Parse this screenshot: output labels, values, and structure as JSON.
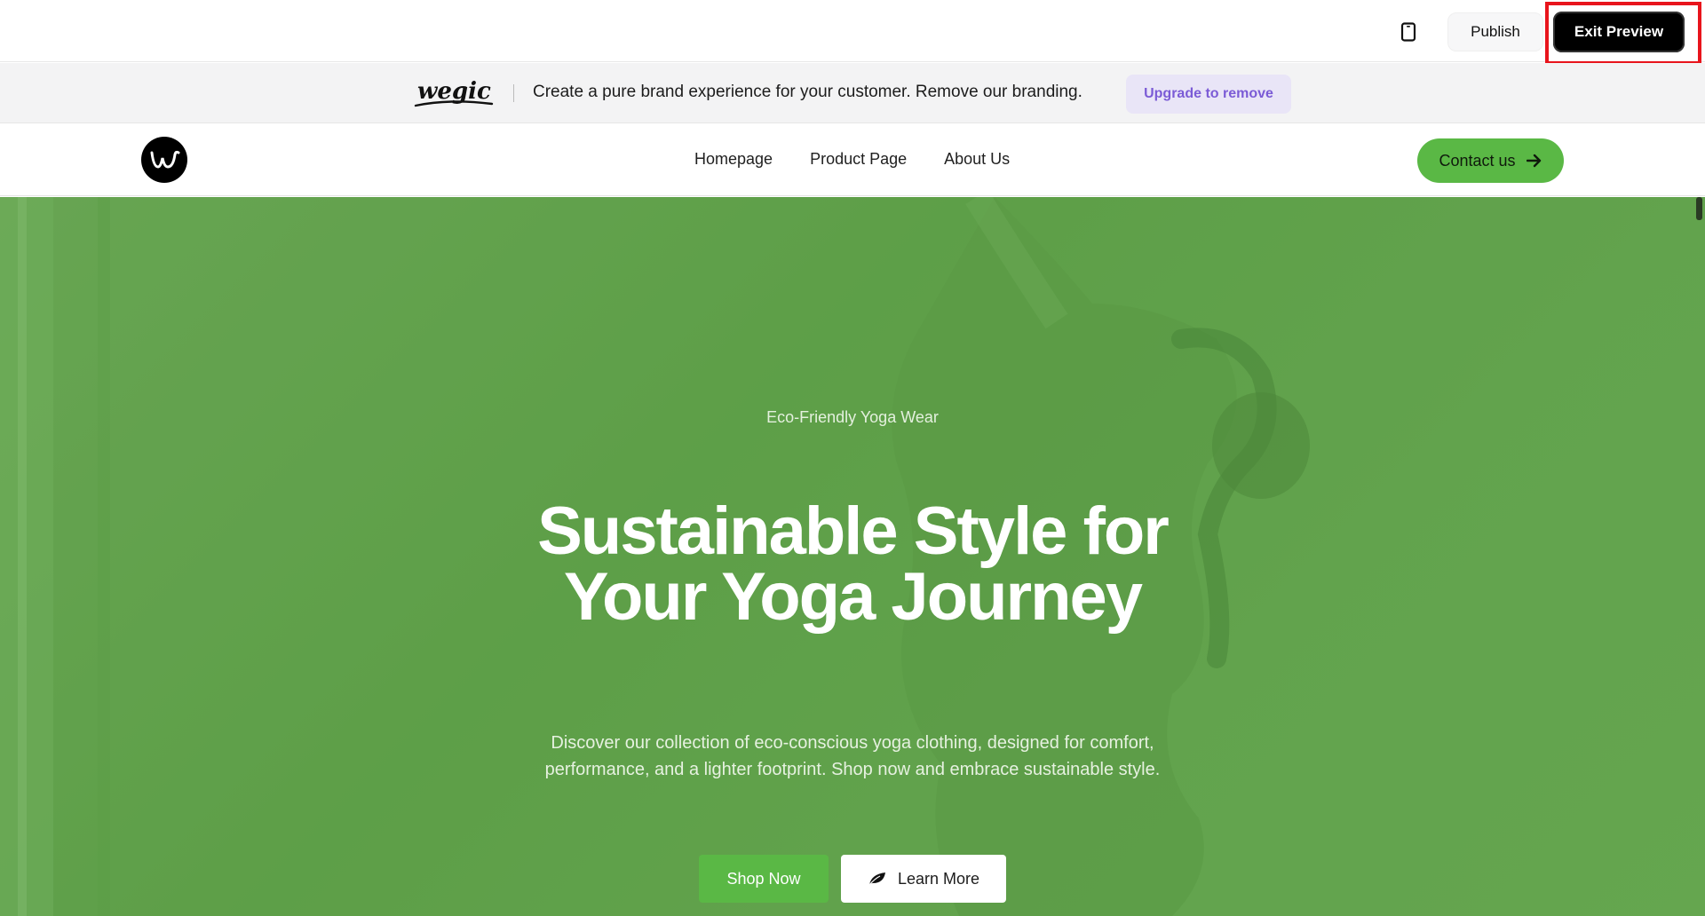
{
  "editor_bar": {
    "device_icon": "mobile-device-icon",
    "publish_label": "Publish",
    "exit_preview_label": "Exit Preview",
    "highlight_color": "#e8141c"
  },
  "banner": {
    "brand_logo_text": "wegic",
    "message": "Create a pure brand experience for your customer. Remove our branding.",
    "upgrade_label": "Upgrade to remove",
    "upgrade_color": "#7b5bd6"
  },
  "site_nav": {
    "logo_icon": "wegic-w-logo",
    "links": [
      "Homepage",
      "Product Page",
      "About Us"
    ],
    "contact_label": "Contact us",
    "contact_icon": "arrow-right-icon",
    "accent_color": "#5ab845"
  },
  "hero": {
    "eyebrow": "Eco-Friendly Yoga Wear",
    "headline": "Sustainable Style for Your Yoga Journey",
    "subtext": "Discover our collection of eco-conscious yoga clothing, designed for comfort, performance, and a lighter footprint. Shop now and embrace sustainable style.",
    "primary_cta": "Shop Now",
    "secondary_cta": "Learn More",
    "secondary_cta_icon": "leaf-icon",
    "background": "woman-in-yoga-pose-green-tint"
  }
}
